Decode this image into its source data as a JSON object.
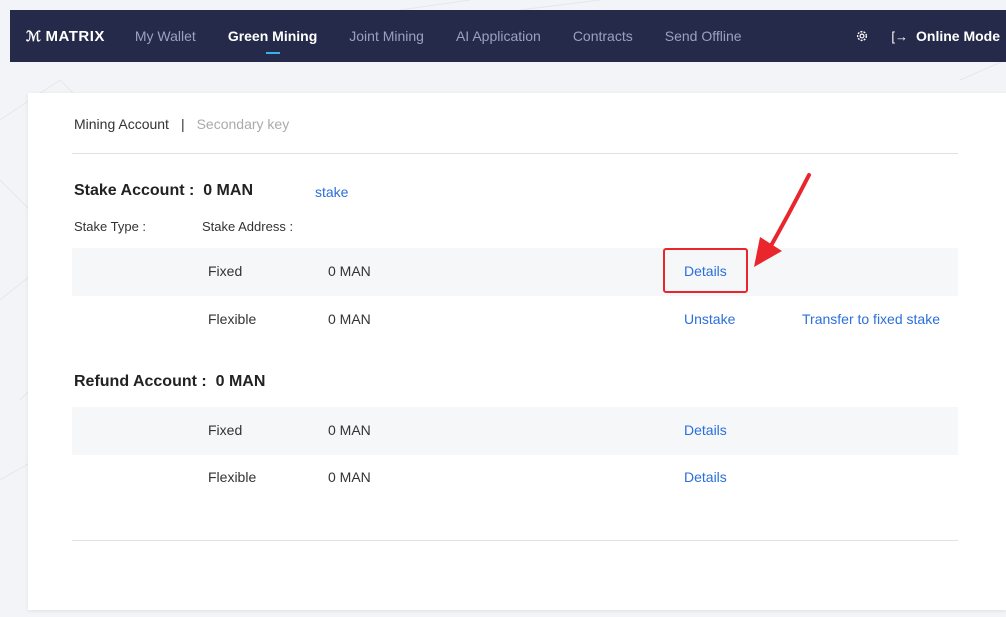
{
  "brand": {
    "name": "MATRIX"
  },
  "nav": {
    "items": [
      {
        "label": "My Wallet",
        "active": false
      },
      {
        "label": "Green Mining",
        "active": true
      },
      {
        "label": "Joint Mining",
        "active": false
      },
      {
        "label": "AI Application",
        "active": false
      },
      {
        "label": "Contracts",
        "active": false
      },
      {
        "label": "Send Offline",
        "active": false
      }
    ],
    "settings_icon": "gear-icon",
    "exit_icon": "exit-icon",
    "mode_label": "Online Mode"
  },
  "tabs": {
    "mining_account": "Mining Account",
    "separator": "|",
    "secondary_key": "Secondary key"
  },
  "stake": {
    "title": "Stake Account :  0 MAN",
    "link": "stake",
    "type_label": "Stake Type :",
    "address_label": "Stake Address :",
    "rows": [
      {
        "type": "Fixed",
        "amount": "0 MAN",
        "action1": "Details",
        "action2": ""
      },
      {
        "type": "Flexible",
        "amount": "0 MAN",
        "action1": "Unstake",
        "action2": "Transfer to fixed stake"
      }
    ]
  },
  "refund": {
    "title": "Refund Account :  0 MAN",
    "rows": [
      {
        "type": "Fixed",
        "amount": "0 MAN",
        "action1": "Details"
      },
      {
        "type": "Flexible",
        "amount": "0 MAN",
        "action1": "Details"
      }
    ]
  },
  "colors": {
    "topbar": "#262a4a",
    "link": "#2a6fdb",
    "annotation": "#e8262b",
    "nav_underline": "#37b1e8"
  }
}
